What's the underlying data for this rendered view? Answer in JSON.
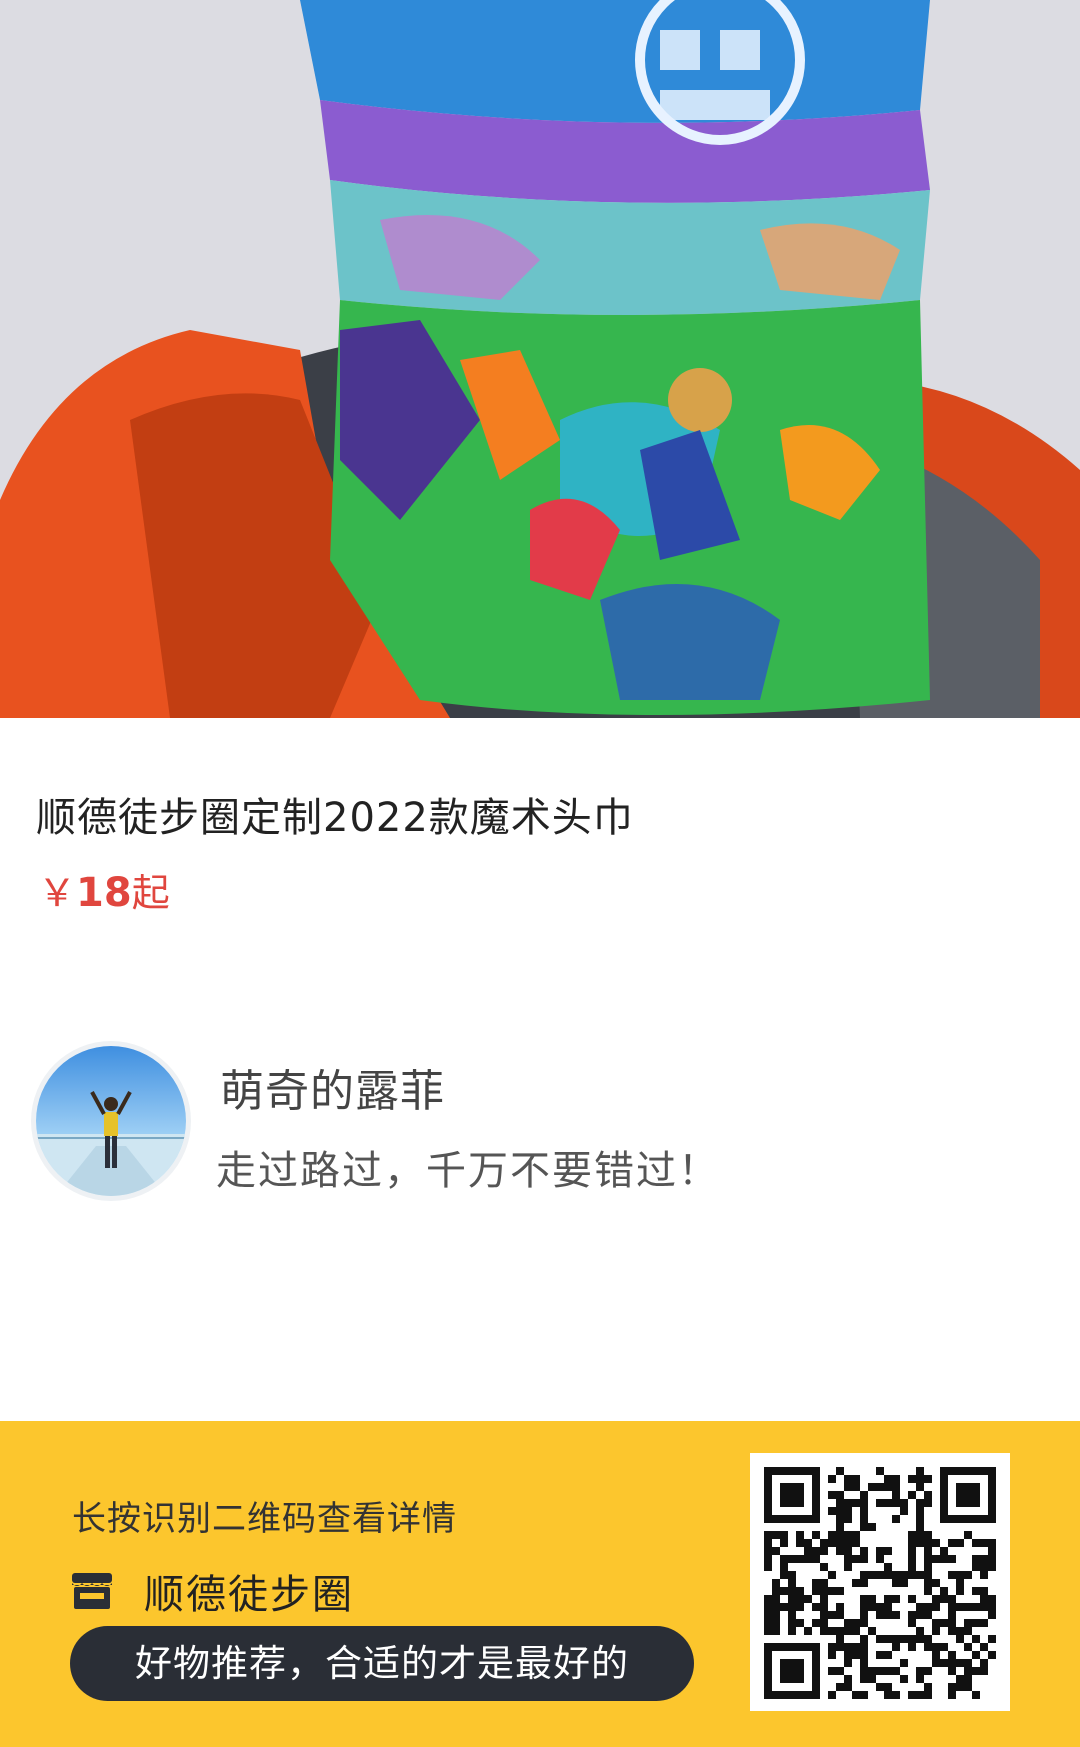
{
  "product": {
    "title": "顺德徒步圈定制2022款魔术头巾",
    "price_symbol": "￥",
    "price_value": "18",
    "price_suffix": "起",
    "image_icon": "neck-gaiter-photo"
  },
  "author": {
    "name": "萌奇的露菲",
    "motto": "走过路过，千万不要错过！",
    "avatar_icon": "hiker-avatar"
  },
  "footer": {
    "hint": "长按识别二维码查看详情",
    "shop_icon": "shop-icon",
    "shop_name": "顺德徒步圈",
    "slogan": "好物推荐，合适的才是最好的",
    "qr_icon": "qr-code"
  },
  "colors": {
    "footer_bg": "#fcc62d",
    "price": "#e0463e",
    "slogan_bg": "#2a2e36"
  }
}
